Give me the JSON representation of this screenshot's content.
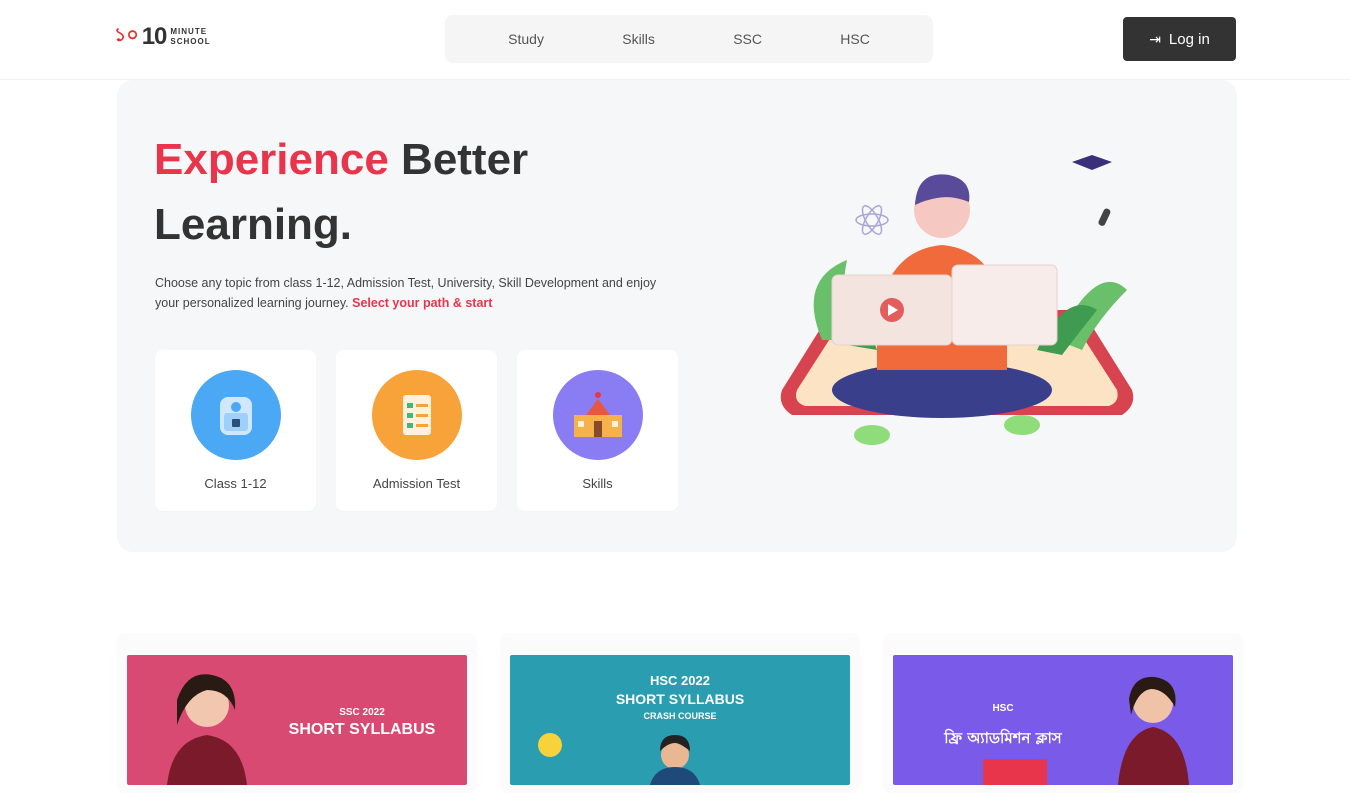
{
  "header": {
    "logo": {
      "mark": "১০",
      "number": "10",
      "word1": "MINUTE",
      "word2": "SCHOOL"
    },
    "nav": [
      "Study",
      "Skills",
      "SSC",
      "HSC"
    ],
    "login": "Log in"
  },
  "hero": {
    "title_accent": "Experience",
    "title_rest": " Better Learning.",
    "description": "Choose any topic from class 1-12, Admission Test, University, Skill Development and enjoy your personalized learning journey. ",
    "cta": "Select your path & start",
    "cards": [
      {
        "label": "Class 1-12",
        "icon": "school-bag-icon",
        "color": "#4aa8f5"
      },
      {
        "label": "Admission Test",
        "icon": "checklist-icon",
        "color": "#f8a23a"
      },
      {
        "label": "Skills",
        "icon": "university-building-icon",
        "color": "#8a7cf2"
      }
    ]
  },
  "courses": [
    {
      "tag": "SSC 2022",
      "title": "SHORT SYLLABUS",
      "color": "#d94a72"
    },
    {
      "tag": "HSC 2022",
      "title": "SHORT SYLLABUS",
      "subtitle": "CRASH COURSE",
      "color": "#2b9db0"
    },
    {
      "tag": "HSC",
      "title": "ফ্রি অ্যাডমিশন ক্লাস",
      "color": "#7a5ae8"
    }
  ],
  "colors": {
    "accent": "#e8354b",
    "dark": "#333333",
    "heroBg": "#f6f7f9"
  }
}
